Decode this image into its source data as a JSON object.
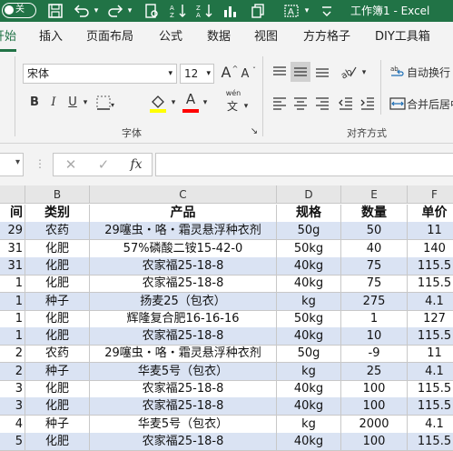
{
  "titlebar": {
    "autosave_label": "关",
    "icons": [
      "save-icon",
      "undo-icon",
      "redo-icon",
      "print-preview-icon",
      "sort-icon",
      "chart-icon",
      "copy-icon",
      "text-icon",
      "dropdown-icon"
    ],
    "window_title": "工作簿1 - Excel"
  },
  "tabs": [
    "开始",
    "插入",
    "页面布局",
    "公式",
    "数据",
    "视图",
    "方方格子",
    "DIY工具箱"
  ],
  "ribbon": {
    "font_name": "宋体",
    "font_size": "12",
    "grow_font": "A",
    "shrink_font": "A",
    "bold": "B",
    "italic": "I",
    "underline": "U",
    "font_color_letter": "A",
    "phonetic": "wén",
    "phonetic_char": "文",
    "wrap_text": "自动换行",
    "merge_center": "合并后居中",
    "group_font": "字体",
    "group_alignment": "对齐方式",
    "colors": {
      "fill": "#ffff00",
      "font": "#ff0000"
    }
  },
  "formula_bar": {
    "cancel": "✕",
    "enter": "✓",
    "fx": "fx",
    "value": ""
  },
  "columns": [
    "",
    "B",
    "C",
    "D",
    "E",
    "F"
  ],
  "rows": [
    {
      "a": "间",
      "b": "类别",
      "c": "产品",
      "d": "规格",
      "e": "数量",
      "f": "单价",
      "header": true,
      "shade": false
    },
    {
      "a": "29",
      "b": "农药",
      "c": "29噻虫・咯・霜灵悬浮种衣剂",
      "d": "50g",
      "e": "50",
      "f": "11",
      "shade": true
    },
    {
      "a": "31",
      "b": "化肥",
      "c": "57%磷酸二铵15-42-0",
      "d": "50kg",
      "e": "40",
      "f": "140",
      "shade": false
    },
    {
      "a": "31",
      "b": "化肥",
      "c": "农家福25-18-8",
      "d": "40kg",
      "e": "75",
      "f": "115.5",
      "shade": true
    },
    {
      "a": "1",
      "b": "化肥",
      "c": "农家福25-18-8",
      "d": "40kg",
      "e": "75",
      "f": "115.5",
      "shade": false
    },
    {
      "a": "1",
      "b": "种子",
      "c": "扬麦25（包衣）",
      "d": "kg",
      "e": "275",
      "f": "4.1",
      "shade": true
    },
    {
      "a": "1",
      "b": "化肥",
      "c": "辉隆复合肥16-16-16",
      "d": "50kg",
      "e": "1",
      "f": "127",
      "shade": false
    },
    {
      "a": "1",
      "b": "化肥",
      "c": "农家福25-18-8",
      "d": "40kg",
      "e": "10",
      "f": "115.5",
      "shade": true
    },
    {
      "a": "2",
      "b": "农药",
      "c": "29噻虫・咯・霜灵悬浮种衣剂",
      "d": "50g",
      "e": "-9",
      "f": "11",
      "shade": false
    },
    {
      "a": "2",
      "b": "种子",
      "c": "华麦5号（包衣）",
      "d": "kg",
      "e": "25",
      "f": "4.1",
      "shade": true
    },
    {
      "a": "3",
      "b": "化肥",
      "c": "农家福25-18-8",
      "d": "40kg",
      "e": "100",
      "f": "115.5",
      "shade": false
    },
    {
      "a": "3",
      "b": "化肥",
      "c": "农家福25-18-8",
      "d": "40kg",
      "e": "100",
      "f": "115.5",
      "shade": true
    },
    {
      "a": "4",
      "b": "种子",
      "c": "华麦5号（包衣）",
      "d": "kg",
      "e": "2000",
      "f": "4.1",
      "shade": false
    },
    {
      "a": "5",
      "b": "化肥",
      "c": "农家福25-18-8",
      "d": "40kg",
      "e": "100",
      "f": "115.5",
      "shade": true
    }
  ]
}
